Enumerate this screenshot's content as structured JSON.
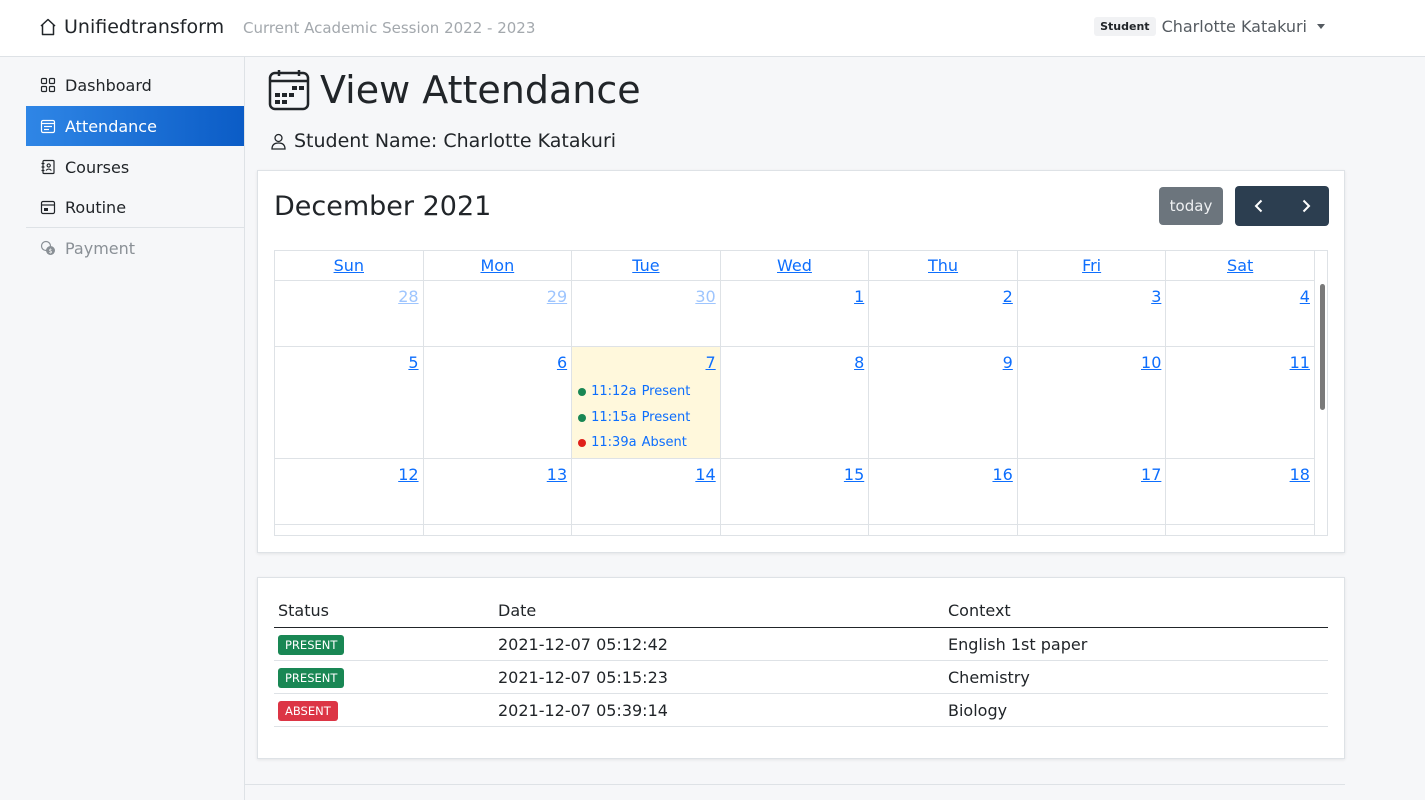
{
  "navbar": {
    "brand": "Unifiedtransform",
    "session": "Current Academic Session 2022 - 2023",
    "role_badge": "Student",
    "user_name": "Charlotte Katakuri"
  },
  "sidebar": {
    "items": [
      {
        "label": "Dashboard",
        "icon": "grid-icon"
      },
      {
        "label": "Attendance",
        "icon": "calendar-check-icon",
        "active": true
      },
      {
        "label": "Courses",
        "icon": "journal-icon"
      },
      {
        "label": "Routine",
        "icon": "calendar-icon"
      },
      {
        "label": "Payment",
        "icon": "coins-icon",
        "disabled": true
      }
    ]
  },
  "page": {
    "title": "View Attendance",
    "student_line": "Student Name: Charlotte Katakuri"
  },
  "calendar": {
    "title": "December 2021",
    "today_label": "today",
    "prev_icon": "chevron-left-icon",
    "next_icon": "chevron-right-icon",
    "weekdays": [
      "Sun",
      "Mon",
      "Tue",
      "Wed",
      "Thu",
      "Fri",
      "Sat"
    ],
    "weeks": [
      [
        "28",
        "29",
        "30",
        "1",
        "2",
        "3",
        "4"
      ],
      [
        "5",
        "6",
        "7",
        "8",
        "9",
        "10",
        "11"
      ],
      [
        "12",
        "13",
        "14",
        "15",
        "16",
        "17",
        "18"
      ]
    ],
    "events": [
      {
        "time": "11:12a",
        "title": "Present",
        "color": "#198754"
      },
      {
        "time": "11:15a",
        "title": "Present",
        "color": "#198754"
      },
      {
        "time": "11:39a",
        "title": "Absent",
        "color": "#dc3545"
      }
    ]
  },
  "attendance_table": {
    "headers": [
      "Status",
      "Date",
      "Context"
    ],
    "rows": [
      {
        "status": "PRESENT",
        "status_color": "#198754",
        "date": "2021-12-07 05:12:42",
        "context": "English 1st paper"
      },
      {
        "status": "PRESENT",
        "status_color": "#198754",
        "date": "2021-12-07 05:15:23",
        "context": "Chemistry"
      },
      {
        "status": "ABSENT",
        "status_color": "#dc3545",
        "date": "2021-12-07 05:39:14",
        "context": "Biology"
      }
    ]
  }
}
